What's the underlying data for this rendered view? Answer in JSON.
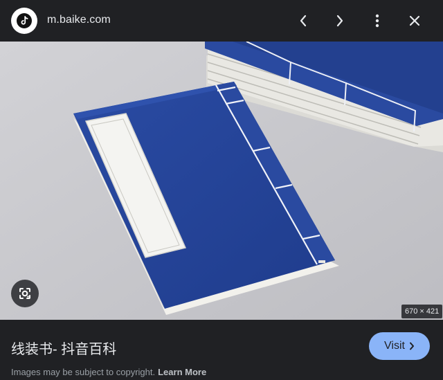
{
  "header": {
    "domain": "m.baike.com",
    "logo_icon": "tiktok-logo-icon",
    "prev_icon": "chevron-left-icon",
    "next_icon": "chevron-right-icon",
    "more_icon": "more-vert-icon",
    "close_icon": "close-icon"
  },
  "preview": {
    "dimensions": "670 × 421",
    "lens_icon": "google-lens-icon",
    "colors": {
      "book_blue": "#24449a",
      "background": "#c8c8cc",
      "paper": "#eeeeea"
    }
  },
  "footer": {
    "title": "线装书- 抖音百科",
    "visit_label": "Visit",
    "visit_icon": "chevron-right-icon",
    "copyright_text": "Images may be subject to copyright.",
    "learn_more": "Learn More",
    "accent_color": "#8ab4f8"
  }
}
